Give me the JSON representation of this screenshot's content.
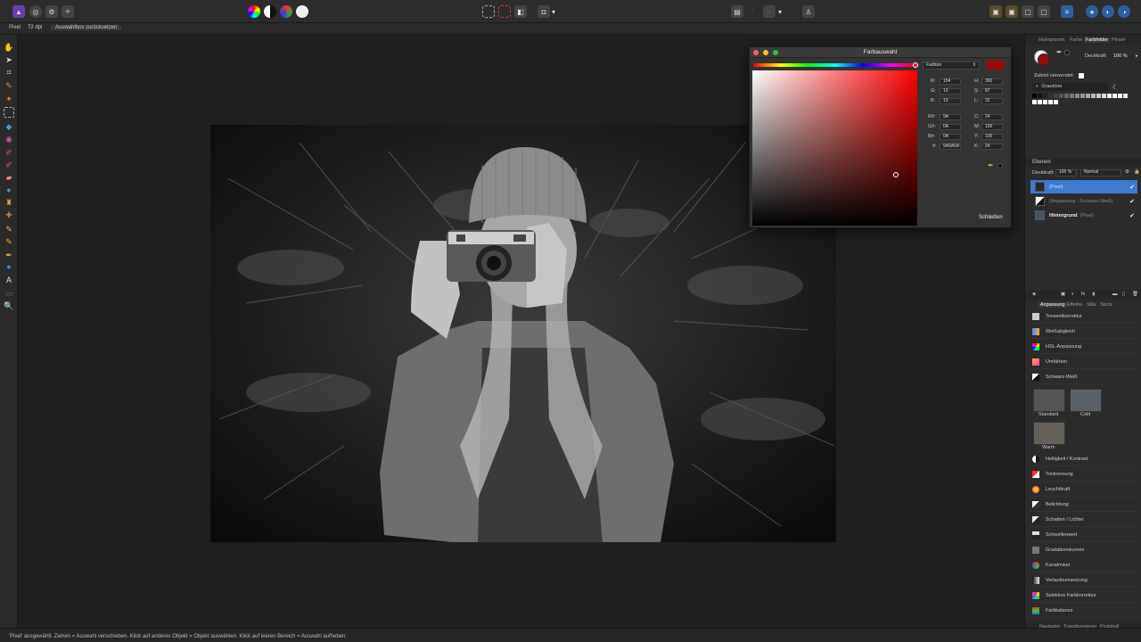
{
  "context_bar": {
    "unit": "Pixel",
    "dpi": "72 dpi",
    "reset_button": "Auswahlbox zurücksetzen"
  },
  "status": {
    "text": "'Pixel' ausgewählt. Ziehen = Auswahl verschieben. Klick auf anderes Objekt = Objekt auswählen. Klick auf leeren Bereich = Auswahl aufheben."
  },
  "color_dialog": {
    "title": "Farbauswahl",
    "mode": "Farbton",
    "r_label": "R:",
    "r_value": "154",
    "g_label": "G:",
    "g_value": "10",
    "b_label": "B:",
    "b_value": "10",
    "h_label": "H:",
    "h_value": "360",
    "s_label": "S:",
    "s_value": "87",
    "l_label": "L:",
    "l_value": "32",
    "rh_label": "R#:",
    "rh_value": "9A",
    "gh_label": "G#:",
    "gh_value": "0A",
    "bh_label": "B#:",
    "bh_value": "0A",
    "hex_label": "#:",
    "hex_value": "9A0A0A",
    "c_label": "C:",
    "c_value": "24",
    "m_label": "M:",
    "m_value": "100",
    "y_label": "Y:",
    "y_value": "100",
    "k_label": "K:",
    "k_value": "24",
    "close_button": "Schließen",
    "current_color": "#9a0a0a"
  },
  "panel": {
    "top_tabs": [
      "Histogramm",
      "Farbe",
      "Farbfelder",
      "Pinsel"
    ],
    "opacity_label": "Deckkraft:",
    "opacity_value": "100 %",
    "recent_label": "Zuletzt verwendet:",
    "palette_name": "Grautöne",
    "layers_title": "Ebenen",
    "layers_opacity_label": "Deckkraft:",
    "layers_opacity_value": "100 %",
    "blend_mode": "Normal",
    "layers": [
      {
        "name": "(Pixel)",
        "selected": true
      },
      {
        "name": "(Anpassung - Schwarz-Weiß)",
        "selected": false
      },
      {
        "name": "Hintergrund",
        "suffix": "(Pixel)",
        "selected": false
      }
    ],
    "adjust_tabs": [
      "Anpassung",
      "Effekte",
      "Stile",
      "Stock"
    ],
    "adjustments_top": [
      "Tonwertkorrektur",
      "Weißabgleich",
      "HSL-Anpassung",
      "Umfärben",
      "Schwarz-Weiß"
    ],
    "presets": [
      "Standard",
      "Cold",
      "Warm"
    ],
    "adjustments_bottom": [
      "Helligkeit / Kontrast",
      "Tontrennung",
      "Leuchtkraft",
      "Belichtung",
      "Schatten / Lichter",
      "Schwellenwert",
      "Gradationskurven",
      "Kanalmixer",
      "Verlaufsumsetzung",
      "Selektive Farbkorrektur",
      "Farbbalance"
    ],
    "bottom_tabs": [
      "Navigator",
      "Transformieren",
      "Protokoll"
    ]
  }
}
